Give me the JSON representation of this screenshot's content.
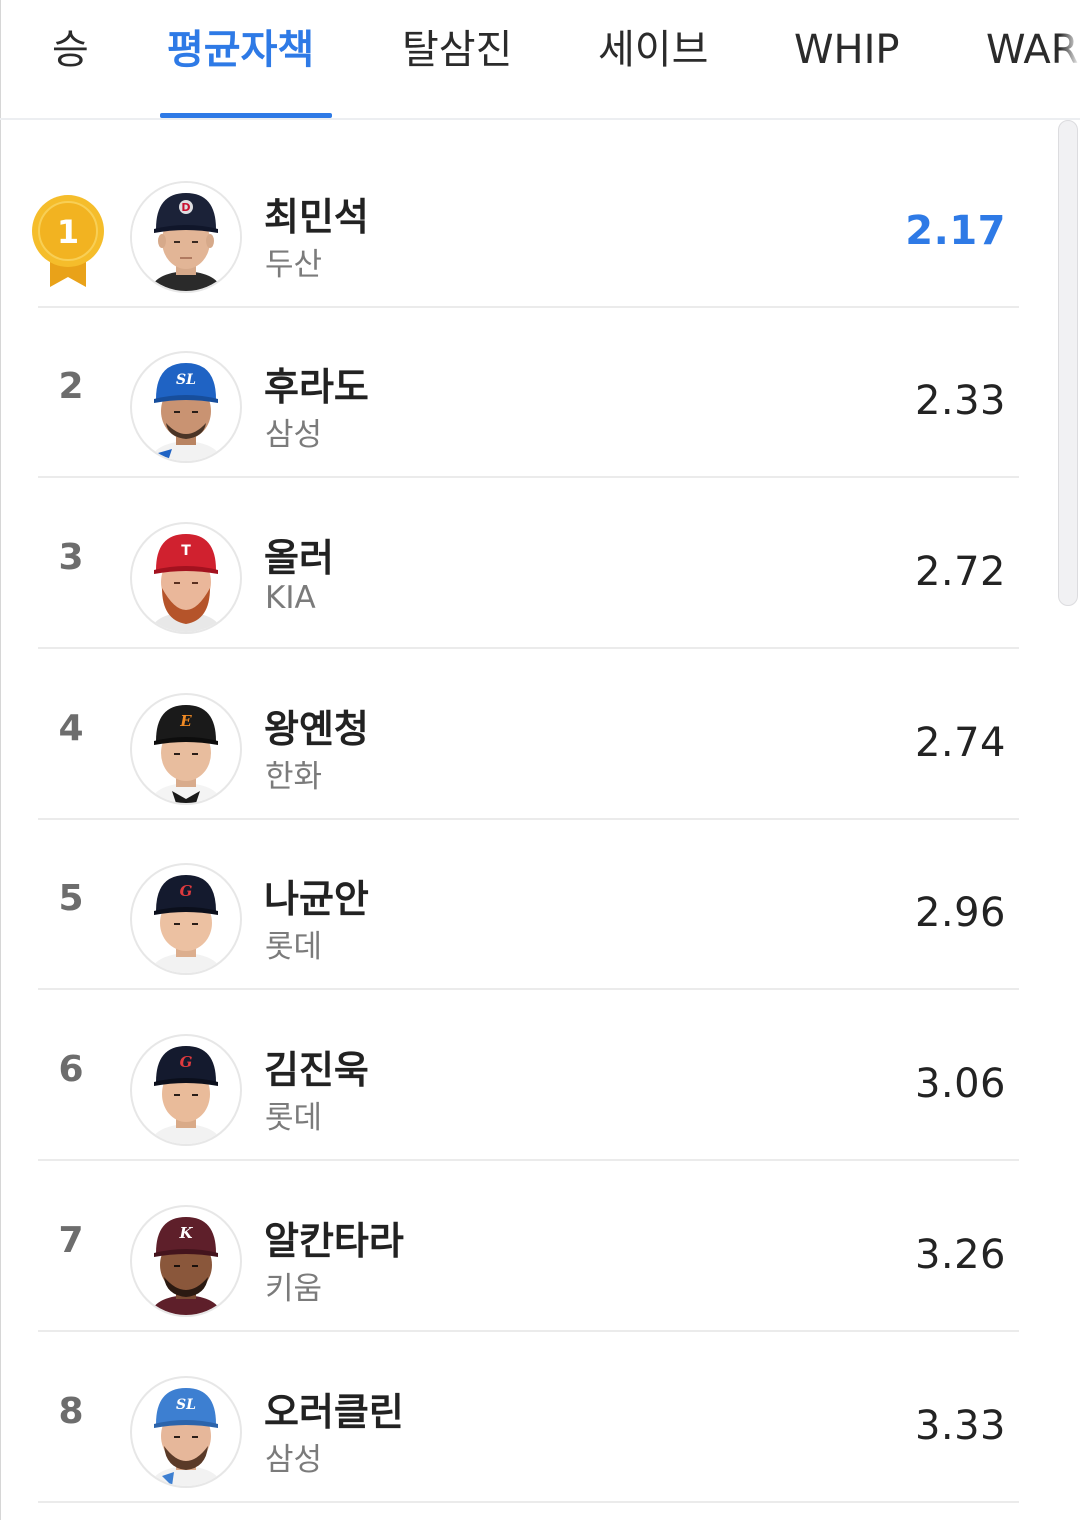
{
  "tabs": [
    {
      "label": "승"
    },
    {
      "label": "평균자책"
    },
    {
      "label": "탈삼진"
    },
    {
      "label": "세이브"
    },
    {
      "label": "WHIP"
    },
    {
      "label": "WAR"
    }
  ],
  "active_tab": "평균자책",
  "colors": {
    "accent": "#2e7ae6",
    "medal_gold": "#f2b321",
    "text": "#222222",
    "muted": "#7b7b7b"
  },
  "rankings": [
    {
      "rank": "1",
      "name": "최민석",
      "team": "두산",
      "value": "2.17",
      "cap_color": "#1b2238",
      "cap_letter": "D",
      "icon": "gold-medal-icon"
    },
    {
      "rank": "2",
      "name": "후라도",
      "team": "삼성",
      "value": "2.33",
      "cap_color": "#1f63c4",
      "cap_letter": "SL"
    },
    {
      "rank": "3",
      "name": "올러",
      "team": "KIA",
      "value": "2.72",
      "cap_color": "#d0212f",
      "cap_letter": "T"
    },
    {
      "rank": "4",
      "name": "왕옌청",
      "team": "한화",
      "value": "2.74",
      "cap_color": "#1a1a1a",
      "cap_letter": "E"
    },
    {
      "rank": "5",
      "name": "나균안",
      "team": "롯데",
      "value": "2.96",
      "cap_color": "#141a2e",
      "cap_letter": "G"
    },
    {
      "rank": "6",
      "name": "김진욱",
      "team": "롯데",
      "value": "3.06",
      "cap_color": "#141a2e",
      "cap_letter": "G"
    },
    {
      "rank": "7",
      "name": "알칸타라",
      "team": "키움",
      "value": "3.26",
      "cap_color": "#5e1f2a",
      "cap_letter": "K"
    },
    {
      "rank": "8",
      "name": "오러클린",
      "team": "삼성",
      "value": "3.33",
      "cap_color": "#3d7fd1",
      "cap_letter": "SL"
    }
  ]
}
